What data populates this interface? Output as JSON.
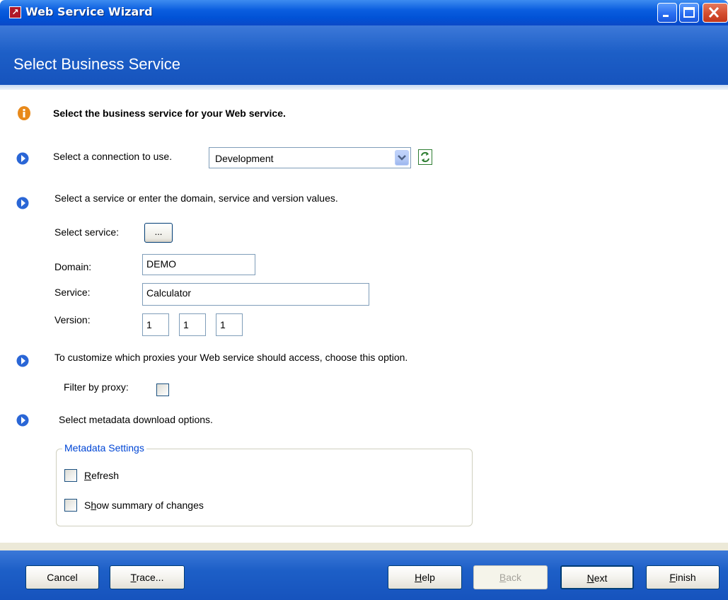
{
  "window": {
    "title": "Web Service Wizard",
    "controls": [
      "minimize-icon",
      "maximize-icon",
      "close-icon"
    ]
  },
  "header": {
    "title": "Select Business Service"
  },
  "intro": {
    "text": "Select the business service for your Web service."
  },
  "connection": {
    "label": "Select a connection to use.",
    "selected": "Development"
  },
  "service_section": {
    "instruction": "Select a service or enter the domain, service and version values.",
    "select_service_label": "Select service:",
    "select_service_button": "...",
    "domain_label": "Domain:",
    "domain_value": "DEMO",
    "service_label": "Service:",
    "service_value": "Calculator",
    "version_label": "Version:",
    "version_values": [
      "1",
      "1",
      "1"
    ]
  },
  "proxy_section": {
    "instruction": "To customize which proxies your Web service should access, choose this option.",
    "filter_label": "Filter by proxy:",
    "filter_checked": false
  },
  "metadata_section": {
    "instruction": "Select metadata download options.",
    "group_title": "Metadata Settings",
    "refresh_label": "Refresh",
    "refresh_checked": false,
    "summary_label": "Show summary of changes",
    "summary_checked": false
  },
  "buttons": {
    "cancel": "Cancel",
    "trace": "Trace...",
    "help": "Help",
    "back": "Back",
    "next": "Next",
    "finish": "Finish"
  },
  "colors": {
    "titlebar": "#0152d6",
    "header": "#1d5fc7",
    "bullet": "#2a66d6",
    "info": "#e8891a",
    "group_title": "#0046d5"
  }
}
